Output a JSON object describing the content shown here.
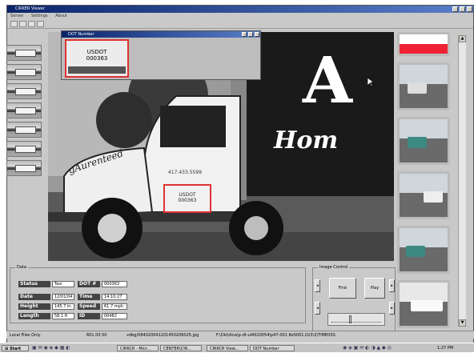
{
  "window": {
    "title": "CIRKER Viewer"
  },
  "menu": [
    "Server",
    "Settings",
    "About"
  ],
  "popup": {
    "title": "DOT Number",
    "plate_line1": "USDOT",
    "plate_line2": "000363"
  },
  "photo": {
    "letter": "A",
    "word": "Hom",
    "brand": "gAurenteed",
    "phone": "417.433.5599",
    "plate_line1": "USDOT",
    "plate_line2": "000363"
  },
  "data_panel": {
    "title": "Data",
    "fields": [
      {
        "label": "Status",
        "value": "Taxi"
      },
      {
        "label": "DOT #",
        "value": "000363"
      },
      {
        "label": "Date",
        "value": "12/01/04"
      },
      {
        "label": "Time",
        "value": "14:10:27"
      },
      {
        "label": "Height",
        "value": "145.7 in."
      },
      {
        "label": "Speed",
        "value": "61.7 mph"
      },
      {
        "label": "Length",
        "value": "58.1 ft"
      },
      {
        "label": "ID",
        "value": "00482"
      }
    ]
  },
  "image_control": {
    "title": "Image Control",
    "first_label": "First",
    "play_label": "Play"
  },
  "status_bar": [
    "Local Files Only",
    "601 00 00",
    "vdbg/084020041201450206025.jpg",
    "F:\\Dkt\\Ana\\p-dt-ul4020054\\p47-001 8e5001.023\\2\\TIME050.80"
  ],
  "taskbar": {
    "start": "Start",
    "tasks": [
      "CIRKCR - Micr...",
      "CENTER\\CIR...",
      "CIRKCR View...",
      "DOT Number"
    ],
    "clock": "1:27 PM"
  }
}
